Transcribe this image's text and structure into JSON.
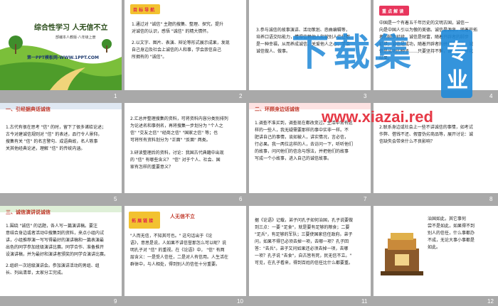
{
  "slides": [
    {
      "num": "1",
      "title": "综合性学习 人无信不立",
      "subtitle": "部编本人教版·八年级上册",
      "footer": "第一PPT模板网-WWW.1PPT.COM"
    },
    {
      "num": "2",
      "badge": "目 标 导 航",
      "lines": [
        "1.通过对 \"诚信\" 主题的搜集、整理、探究，提升",
        "对诚信的认识，感悟 \"诚信\" 的精大情怀。",
        "",
        "2.以文字、图片、表演、辩论等形式展示成果，发现",
        "自己身边及社会上诚信的人和事，学会崇信自己",
        "所拥有的 \"诚信\"。"
      ]
    },
    {
      "num": "3",
      "lines": [
        "3.参与诚信的故事演讲、活动策划、悲曲编辑等，",
        "培养口语交际能力，懂得信赖他人和被别人信任都",
        "是一种幸福，从而养成诚信、关爱他人之心，学会",
        "诚信做人、做事。"
      ]
    },
    {
      "num": "4",
      "badge": "重 点 解 读",
      "lines": [
        "中国是一个有着五千年历史的文明古国，诚信一",
        "向是中国人引以为傲的美德。诚信是源泉，随着开拓",
        "者的脚步延续，诚信是财富，随着开辟者的脚步",
        "延续；诚信是成功，随着开辟者的拼搏而得之。诚",
        "信是成功的种子……只要坚持不懈，诚信必定开花",
        "结果。"
      ]
    },
    {
      "num": "5",
      "head": "一、引经据典话诚信",
      "lines": [
        "1.古代有很在思考 \"信\" 的时，留下了很多诸给论述；",
        "古今对建诚信规则对 \"信\" 的表述，品行令人景仰。",
        "搜集有关 \"信\" 的名言警句、成语典故，名人轶事",
        "关其他经典论述，理解 \"信\" 的传统内涵。"
      ]
    },
    {
      "num": "6",
      "lines": [
        "2.汇总并整理搜集的资料，可将资料内容分类别排列",
        "为论述名和事例名，再将搜集一步划分为 \"个人之",
        "信\" \"交友之信\" \"经商之信\" \"国家之信\" 等；也",
        "可将所有资料划分为 \"正面\" \"反面\" 两类。",
        "",
        "3.研读整理后的资料，讨论：我国古代典籍中出现",
        "的 \"信\" 有哪些含义？ \"信\" 对于个人、社会、国",
        "家有怎样的重要意义？"
      ]
    },
    {
      "num": "7",
      "head": "二、环顾身边话诚信",
      "lines": [
        "1.调查不准买到，调查现在都改变过。生活中常有这",
        "样的一些人，我无疑需要那样的事中实非一样。不",
        "肥讲自己的事情，谈如被人，讲实情况，言必信，",
        "行必果。我一两位这样的人，去访问一下，听听他们",
        "的故事，问问他们的信念与想法，并把他们的故事",
        "写成一个小故事，进入自己的诚信故事。"
      ]
    },
    {
      "num": "8",
      "lines": [
        "2.联系身边或社会上一些不讲诚信的事情，如考试",
        "作弊、借钱不还、假冒伪劣商品等，展开讨论：诚",
        "信缺失会带来什么不良影响？"
      ]
    },
    {
      "num": "9",
      "head": "三、诚信演讲说诚信",
      "lines": [
        "1.围绕 \"诚信\" 的话题，各人写一篇演讲稿。要注",
        "意结合身边或者活动中搜集到的资料，来点小组内试",
        "讲，小组推荐演一写写得最好的演讲稿和一篇表演最",
        "出色的同学参加班级演讲比赛。同学合作、准备推开",
        "设演讲稿，并为最好和演讲者颁奖的同学合演讲比赛。",
        "",
        "2.组织一次班级演讲会。参加演讲活动的男组、组",
        "长、列出清单，太家分工完成。"
      ]
    },
    {
      "num": "10",
      "badge": "拓 展 链 接",
      "title": "人无信不立",
      "lines": [
        "\"人而无信，不知其可也。\" 这句话出于《论",
        "语》，意思是说，人如果不讲信誉那怎么可以呢？说",
        "明孔子对 \"信\" 的重视。在《论语》中， \"信\" 有两",
        "层含义：一是受人信任，二是对人有信用。人生活在",
        "群体中，与人相处，得到别人的信任十分重要。"
      ]
    },
    {
      "num": "11",
      "lines": [
        "据《论语》记载，弟子问孔子如何治国，孔子说要做",
        "到三点：一要 \"足食\"，就是要有足够的粮食；二要",
        "\"足兵\"，有足够的军队；三要使国家信任政府。弟子",
        "问，如果不得已必须去掉一项，去哪一项？孔子回",
        "答：\"去兵\"。弟子又问如果还必须去掉一项，去哪",
        "一项？孔子说 \"去食\"，自古皆有死，民无信不立。\"",
        "可见，在孔子看来，得到百姓的信任比什么都要重。"
      ]
    },
    {
      "num": "12",
      "lines": [
        "治国如此，其它事何",
        "尝不是如此，如果得不到",
        "别人的信任，什么事都办",
        "不成，无论大事小事都是",
        "如此。"
      ]
    }
  ],
  "watermark": {
    "brand": "下载集",
    "domain": "www.xiazai.red",
    "side1": "专",
    "side2": "业"
  },
  "colors": {
    "accent": "#e8365d",
    "grass": "#7bbf3a",
    "sky": "#2e8bd6",
    "yellow": "#f2c230"
  }
}
